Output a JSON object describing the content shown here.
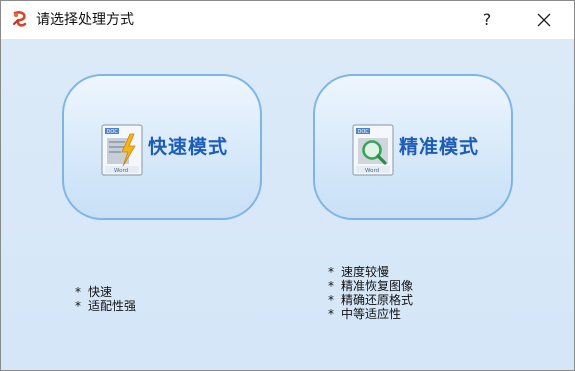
{
  "window": {
    "title": "请选择处理方式",
    "help_label": "?"
  },
  "icons": {
    "app": "app-logo-icon",
    "help": "question-mark-icon",
    "close": "close-icon",
    "fast": "word-doc-lightning-icon",
    "precise": "word-doc-magnifier-icon"
  },
  "modes": {
    "fast": {
      "label": "快速模式",
      "features": [
        "快速",
        "适配性强"
      ]
    },
    "precise": {
      "label": "精准模式",
      "features": [
        "速度较慢",
        "精准恢复图像",
        "精确还原格式",
        "中等适应性"
      ]
    }
  },
  "bullet": "*",
  "colors": {
    "accent": "#1d5db6",
    "button_border": "#7fb5e6",
    "background": "#d8e8f8"
  }
}
